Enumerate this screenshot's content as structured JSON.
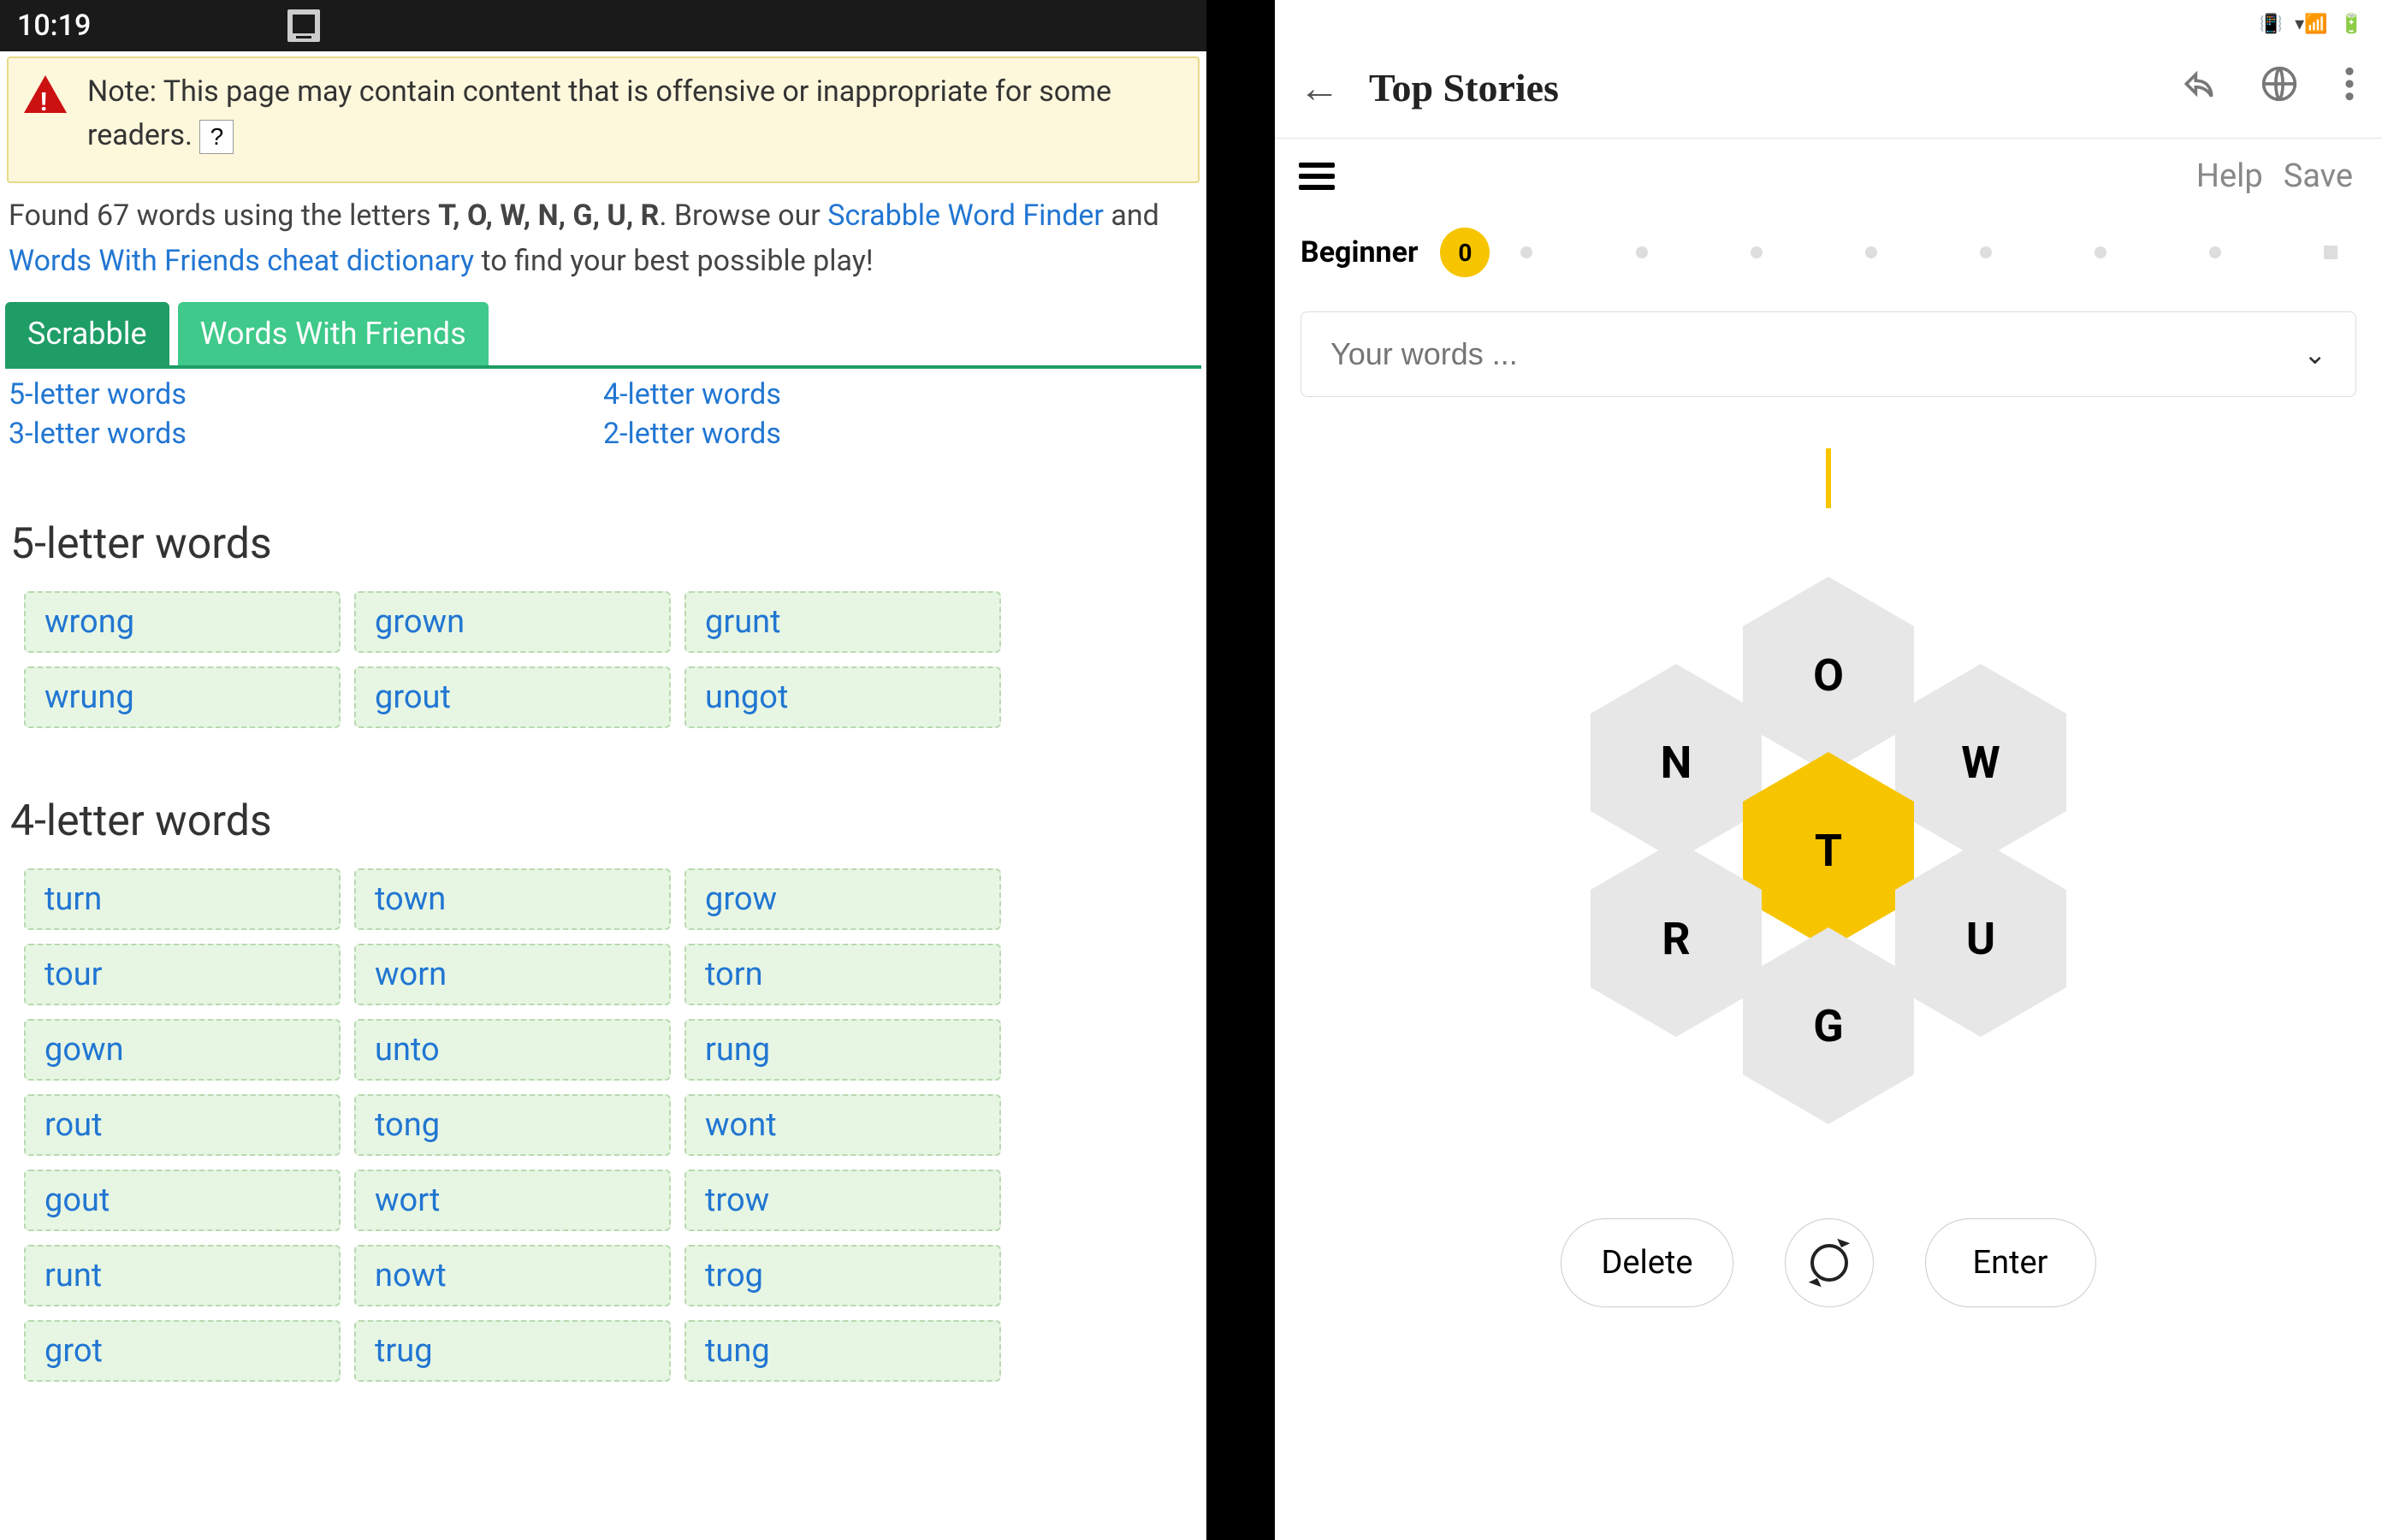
{
  "status": {
    "time": "10:19"
  },
  "left": {
    "warning": "Note: This page may contain content that is offensive or inappropriate for some readers.",
    "help_q": "?",
    "found_prefix": "Found 67 words using the letters ",
    "letters_bold": "T, O, W, N, G, U, R",
    "browse_text": ". Browse our ",
    "link1": "Scrabble Word Finder",
    "and_text": " and ",
    "link2": "Words With Friends cheat dictionary",
    "after_link": " to find your best possible play!",
    "tabs": {
      "scrabble": "Scrabble",
      "wwf": "Words With Friends"
    },
    "quicklinks": {
      "l5": "5-letter words",
      "l4": "4-letter words",
      "l3": "3-letter words",
      "l2": "2-letter words"
    },
    "section5_title": "5-letter words",
    "words5": [
      "wrong",
      "grown",
      "grunt",
      "wrung",
      "grout",
      "ungot"
    ],
    "section4_title": "4-letter words",
    "words4": [
      "turn",
      "town",
      "grow",
      "tour",
      "worn",
      "torn",
      "gown",
      "unto",
      "rung",
      "rout",
      "tong",
      "wont",
      "gout",
      "wort",
      "trow",
      "runt",
      "nowt",
      "trog",
      "grot",
      "trug",
      "tung"
    ]
  },
  "right": {
    "header_title": "Top Stories",
    "help": "Help",
    "save": "Save",
    "rank_label": "Beginner",
    "rank_score": "0",
    "words_placeholder": "Your words ...",
    "hex": {
      "top": "O",
      "tl": "N",
      "tr": "W",
      "center": "T",
      "bl": "R",
      "br": "U",
      "bottom": "G"
    },
    "delete": "Delete",
    "enter": "Enter"
  }
}
